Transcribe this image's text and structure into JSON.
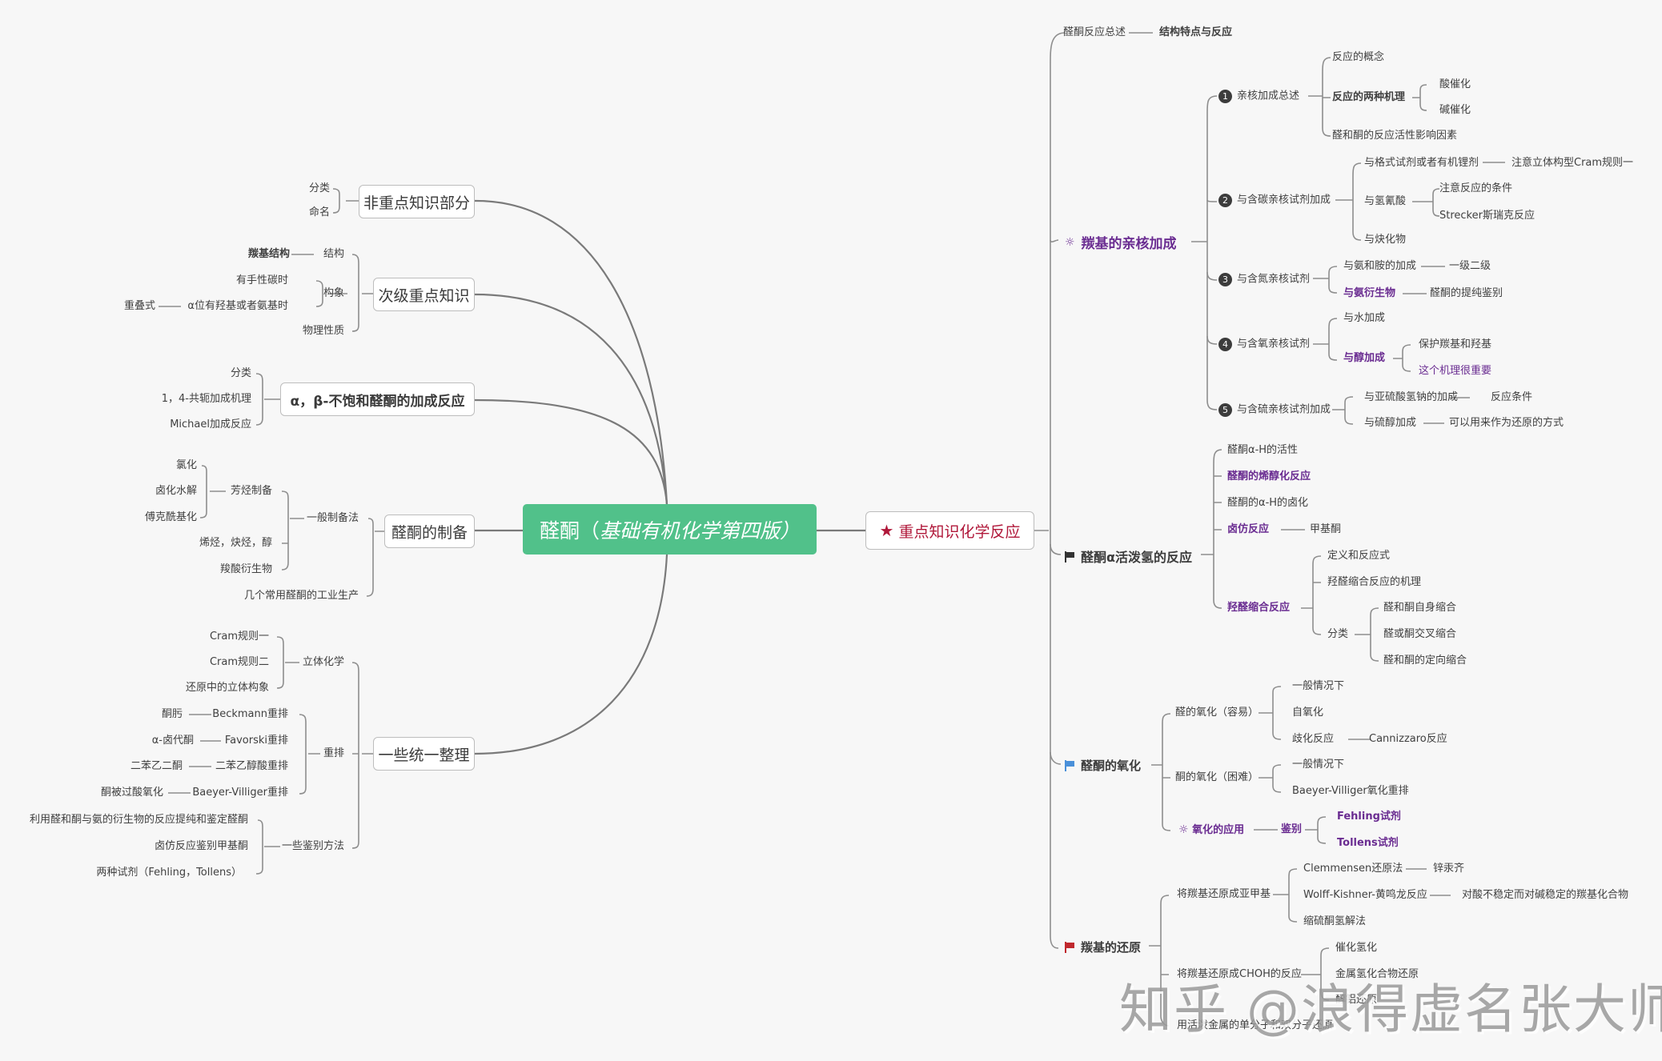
{
  "root": {
    "title_plain": "醛酮（",
    "title_italic": "基础有机化学第四版）",
    "color": "#51c18a"
  },
  "left": {
    "b1": {
      "label": "非重点知识部分",
      "children": [
        "分类",
        "命名"
      ]
    },
    "b2": {
      "label": "次级重点知识",
      "jiegou": "结构",
      "jiegou_child": "羰基结构",
      "gouxiang": "构象",
      "gouxiang_children": [
        "有手性碳时",
        "α位有羟基或者氨基时"
      ],
      "chongdie": "重叠式",
      "wuli": "物理性质"
    },
    "b3": {
      "label": "α，β-不饱和醛酮的加成反应",
      "children": [
        "分类",
        "1，4-共轭加成机理",
        "Michael加成反应"
      ]
    },
    "b4": {
      "label": "醛酮的制备",
      "general": "一般制备法",
      "aromatic": "芳烃制备",
      "aromatic_children": [
        "氯化",
        "卤化水解",
        "傅克酰基化"
      ],
      "others": [
        "烯烃，炔烃，醇",
        "羧酸衍生物"
      ],
      "industry": "几个常用醛酮的工业生产"
    },
    "b5": {
      "label": "一些统一整理",
      "stereo": "立体化学",
      "stereo_children": [
        "Cram规则一",
        "Cram规则二",
        "还原中的立体构象"
      ],
      "rearr": "重排",
      "rearr_children": [
        {
          "name": "Beckmann重排",
          "from": "酮肟"
        },
        {
          "name": "Favorski重排",
          "from": "α-卤代酮"
        },
        {
          "name": "二苯乙醇酸重排",
          "from": "二苯乙二酮"
        },
        {
          "name": "Baeyer-Villiger重排",
          "from": "酮被过酸氧化"
        }
      ],
      "ident": "一些鉴别方法",
      "ident_children": [
        "利用醛和酮与氨的衍生物的反应提纯和鉴定醛酮",
        "卤仿反应鉴别甲基酮",
        "两种试剂（Fehling，Tollens）"
      ]
    }
  },
  "right": {
    "main": {
      "label": "重点知识化学反应",
      "color": "#b0183a"
    },
    "overview": {
      "label": "醛酮反应总述",
      "child": "结构特点与反应"
    },
    "nuc": {
      "label": "羰基的亲核加成",
      "s1": {
        "num": "1",
        "label": "亲核加成总述",
        "c1": "反应的概念",
        "c2": "反应的两种机理",
        "c2a": "酸催化",
        "c2b": "碱催化",
        "c3": "醛和酮的反应活性影响因素"
      },
      "s2": {
        "num": "2",
        "label": "与含碳亲核试剂加成",
        "c1": "与格式试剂或者有机锂剂",
        "c1a": "注意立体构型Cram规则一",
        "c2": "与氢氰酸",
        "c2a": "注意反应的条件",
        "c2b": "Strecker斯瑞克反应",
        "c3": "与炔化物"
      },
      "s3": {
        "num": "3",
        "label": "与含氮亲核试剂",
        "c1": "与氨和胺的加成",
        "c1a": "一级二级",
        "c2": "与氨衍生物",
        "c2a": "醛酮的提纯鉴别"
      },
      "s4": {
        "num": "4",
        "label": "与含氧亲核试剂",
        "c1": "与水加成",
        "c2": "与醇加成",
        "c2a": "保护羰基和羟基",
        "c2b": "这个机理很重要"
      },
      "s5": {
        "num": "5",
        "label": "与含硫亲核试剂加成",
        "c1": "与亚硫酸氢钠的加成",
        "c1a": "反应条件",
        "c2": "与硫醇加成",
        "c2a": "可以用来作为还原的方式"
      }
    },
    "alpha": {
      "label": "醛酮α活泼氢的反应",
      "c1": "醛酮α-H的活性",
      "c2": "醛酮的烯醇化反应",
      "c3": "醛酮的α-H的卤化",
      "c4": "卤仿反应",
      "c4a": "甲基酮",
      "c5": "羟醛缩合反应",
      "c5a": "定义和反应式",
      "c5b": "羟醛缩合反应的机理",
      "c5c": "分类",
      "c5c_children": [
        "醛和酮自身缩合",
        "醛或酮交叉缩合",
        "醛和酮的定向缩合"
      ]
    },
    "ox": {
      "label": "醛酮的氧化",
      "a": "醛的氧化（容易）",
      "a_children": [
        "一般情况下",
        "自氧化",
        "歧化反应"
      ],
      "a3_child": "Cannizzaro反应",
      "k": "酮的氧化（困难）",
      "k_children": [
        "一般情况下",
        "Baeyer-Villiger氧化重排"
      ],
      "app": "氧化的应用",
      "ident": "鉴别",
      "ident_children": [
        "Fehling试剂",
        "Tollens试剂"
      ]
    },
    "red": {
      "label": "羰基的还原",
      "m1": "将羰基还原成亚甲基",
      "m1_children": [
        "Clemmensen还原法",
        "Wolff-Kishner-黄鸣龙反应",
        "缩硫酮氢解法"
      ],
      "m1a": "锌汞齐",
      "m1b": "对酸不稳定而对碱稳定的羰基化合物",
      "m2": "将羰基还原成CHOH的反应",
      "m2_children": [
        "催化氢化",
        "金属氢化合物还原",
        "醇铝还原"
      ],
      "m3": "用活泼金属的单分子和双分子还原"
    }
  },
  "watermark": "知乎 @浪得虚名张大师",
  "icons": {
    "star": "★",
    "bulb": "💡"
  }
}
